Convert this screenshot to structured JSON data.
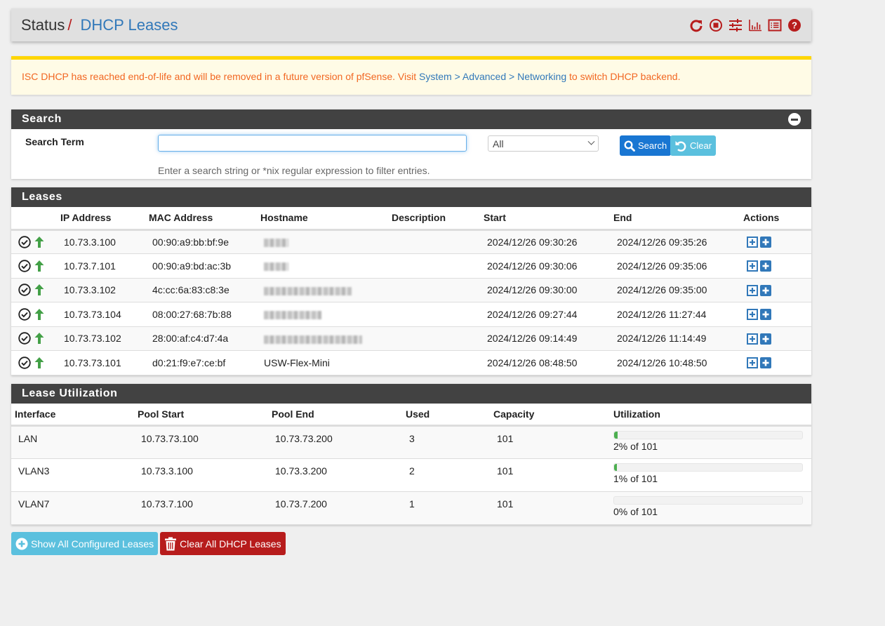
{
  "breadcrumb": {
    "parent": "Status",
    "separator": "/",
    "current": "DHCP Leases"
  },
  "header_icons": [
    "reload-icon",
    "stop-icon",
    "settings-sliders-icon",
    "bar-chart-icon",
    "log-list-icon",
    "help-icon"
  ],
  "alert": {
    "text_before": "ISC DHCP has reached end-of-life and will be removed in a future version of pfSense. Visit ",
    "link_text": "System > Advanced > Networking",
    "text_after": " to switch DHCP backend."
  },
  "search": {
    "panel_title": "Search",
    "label": "Search Term",
    "input_value": "",
    "select_value": "All",
    "search_button": "Search",
    "clear_button": "Clear",
    "help_text": "Enter a search string or *nix regular expression to filter entries."
  },
  "leases": {
    "panel_title": "Leases",
    "columns": [
      "",
      "IP Address",
      "MAC Address",
      "Hostname",
      "Description",
      "Start",
      "End",
      "Actions"
    ],
    "rows": [
      {
        "ip": "10.73.3.100",
        "mac": "00:90:a9:bb:bf:9e",
        "hostname": "",
        "hostname_redacted": true,
        "description": "",
        "start": "2024/12/26 09:30:26",
        "end": "2024/12/26 09:35:26"
      },
      {
        "ip": "10.73.7.101",
        "mac": "00:90:a9:bd:ac:3b",
        "hostname": "",
        "hostname_redacted": true,
        "description": "",
        "start": "2024/12/26 09:30:06",
        "end": "2024/12/26 09:35:06"
      },
      {
        "ip": "10.73.3.102",
        "mac": "4c:cc:6a:83:c8:3e",
        "hostname": "",
        "hostname_redacted": true,
        "description": "",
        "start": "2024/12/26 09:30:00",
        "end": "2024/12/26 09:35:00"
      },
      {
        "ip": "10.73.73.104",
        "mac": "08:00:27:68:7b:88",
        "hostname": "",
        "hostname_redacted": true,
        "description": "",
        "start": "2024/12/26 09:27:44",
        "end": "2024/12/26 11:27:44"
      },
      {
        "ip": "10.73.73.102",
        "mac": "28:00:af:c4:d7:4a",
        "hostname": "",
        "hostname_redacted": true,
        "description": "",
        "start": "2024/12/26 09:14:49",
        "end": "2024/12/26 11:14:49"
      },
      {
        "ip": "10.73.73.101",
        "mac": "d0:21:f9:e7:ce:bf",
        "hostname": "USW-Flex-Mini",
        "hostname_redacted": false,
        "description": "",
        "start": "2024/12/26 08:48:50",
        "end": "2024/12/26 10:48:50"
      }
    ]
  },
  "utilization": {
    "panel_title": "Lease Utilization",
    "columns": [
      "Interface",
      "Pool Start",
      "Pool End",
      "Used",
      "Capacity",
      "Utilization"
    ],
    "rows": [
      {
        "interface": "LAN",
        "pool_start": "10.73.73.100",
        "pool_end": "10.73.73.200",
        "used": "3",
        "capacity": "101",
        "percent": 2,
        "label": "2% of 101"
      },
      {
        "interface": "VLAN3",
        "pool_start": "10.73.3.100",
        "pool_end": "10.73.3.200",
        "used": "2",
        "capacity": "101",
        "percent": 1,
        "label": "1% of 101"
      },
      {
        "interface": "VLAN7",
        "pool_start": "10.73.7.100",
        "pool_end": "10.73.7.200",
        "used": "1",
        "capacity": "101",
        "percent": 0,
        "label": "0% of 101"
      }
    ]
  },
  "buttons": {
    "show_all": "Show All Configured Leases",
    "clear_all": "Clear All DHCP Leases"
  },
  "colors": {
    "accent_blue": "#1976d2",
    "link_blue": "#3178b9",
    "danger_red": "#b71c1c",
    "info_cyan": "#5bc0de",
    "success_green": "#4caf50",
    "warning_orange": "#f26722"
  }
}
